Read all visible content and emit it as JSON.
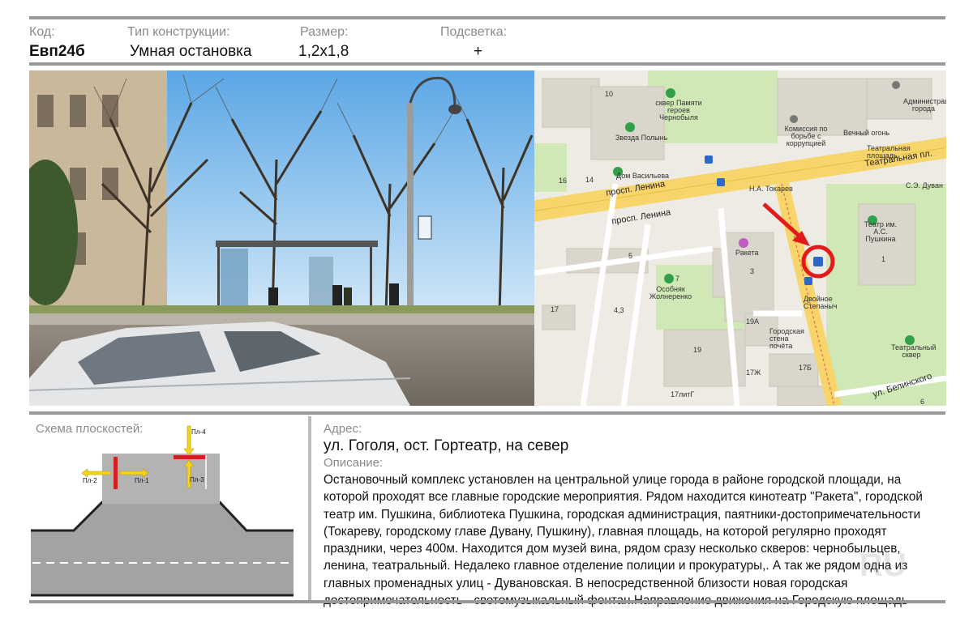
{
  "header": {
    "code_label": "Код:",
    "type_label": "Тип конструкции:",
    "size_label": "Размер:",
    "light_label": "Подсветка:",
    "code_value": "Евп24б",
    "type_value": "Умная остановка",
    "size_value": "1,2x1,8",
    "light_value": "+"
  },
  "map": {
    "streets": {
      "lenina_upper": "просп. Ленина",
      "lenina_lower": "просп. Ленина",
      "teatralnaya": "Театральная пл.",
      "belinskogo": "ул. Белинского"
    },
    "places": {
      "skver_chernobyl": "сквер Памяти героев Чернобыля",
      "zvezda_polyn": "Звезда Полынь",
      "dom_vasilyeva": "Дом Васильева",
      "administration": "Администрация города",
      "commission": "Комиссия по борьбе с коррупцией",
      "vechny_ogon": "Вечный огонь",
      "teatralnaya_ploshad": "Театральная площадь",
      "tokarev": "Н.А. Токарев",
      "duvan": "С.Э. Дуван",
      "theatre": "Театр им. А.С. Пушкина",
      "raketa": "Ракета",
      "osobnyak": "Особняк Жолнеренко",
      "dvoinoe": "Двойное Степаныч",
      "pochta": "Городская стена почёта",
      "teatralny_skver": "Театральный сквер"
    },
    "numbers": {
      "n10": "10",
      "n14": "14",
      "n16": "16",
      "n5": "5",
      "n3": "3",
      "n7": "7",
      "n17": "17",
      "n19": "19",
      "n19a": "19А",
      "n17zh": "17Ж",
      "n17b": "17Б",
      "n17litg": "17литГ",
      "n1": "1",
      "n6": "6",
      "n4": "4,3"
    }
  },
  "schema": {
    "title": "Схема плоскостей:",
    "planes": [
      "Пл-1",
      "Пл-2",
      "Пл-3",
      "Пл-4"
    ]
  },
  "address": {
    "label": "Адрес:",
    "value": "ул. Гоголя, ост. Гортеатр, на север"
  },
  "description": {
    "label": "Описание:",
    "text": "Остановочный комплекс установлен на центральной улице города в районе городской площади, на которой проходят все главные городские мероприятия. Рядом находится кинотеатр \"Ракета\", городской театр им. Пушкина, библиотека Пушкина, городская администрация, паятники-достопримечательности (Токареву, городскому главе Дувану, Пушкину), главная площадь, на которой регулярно проходят праздники, через 400м. Находится дом музей вина, рядом сразу несколько скверов: чернобыльцев, ленина, театральный. Недалеко главное отделение полиции и прокуратуры,. А так же рядом одна из главных променадных улиц - Дувановская. В непосредственной близости новая городская достопримечательность - светомузыкальный фонтан.Направление движения на Городскую площадь"
  },
  "watermark": "RU",
  "colors": {
    "marker_red": "#e11b1b",
    "plane_red": "#d32020",
    "arrow_yellow": "#f4d31b",
    "road_gray": "#9d9d9d",
    "map_yellow_road": "#f7d56a",
    "map_green": "#cfe8b5"
  }
}
